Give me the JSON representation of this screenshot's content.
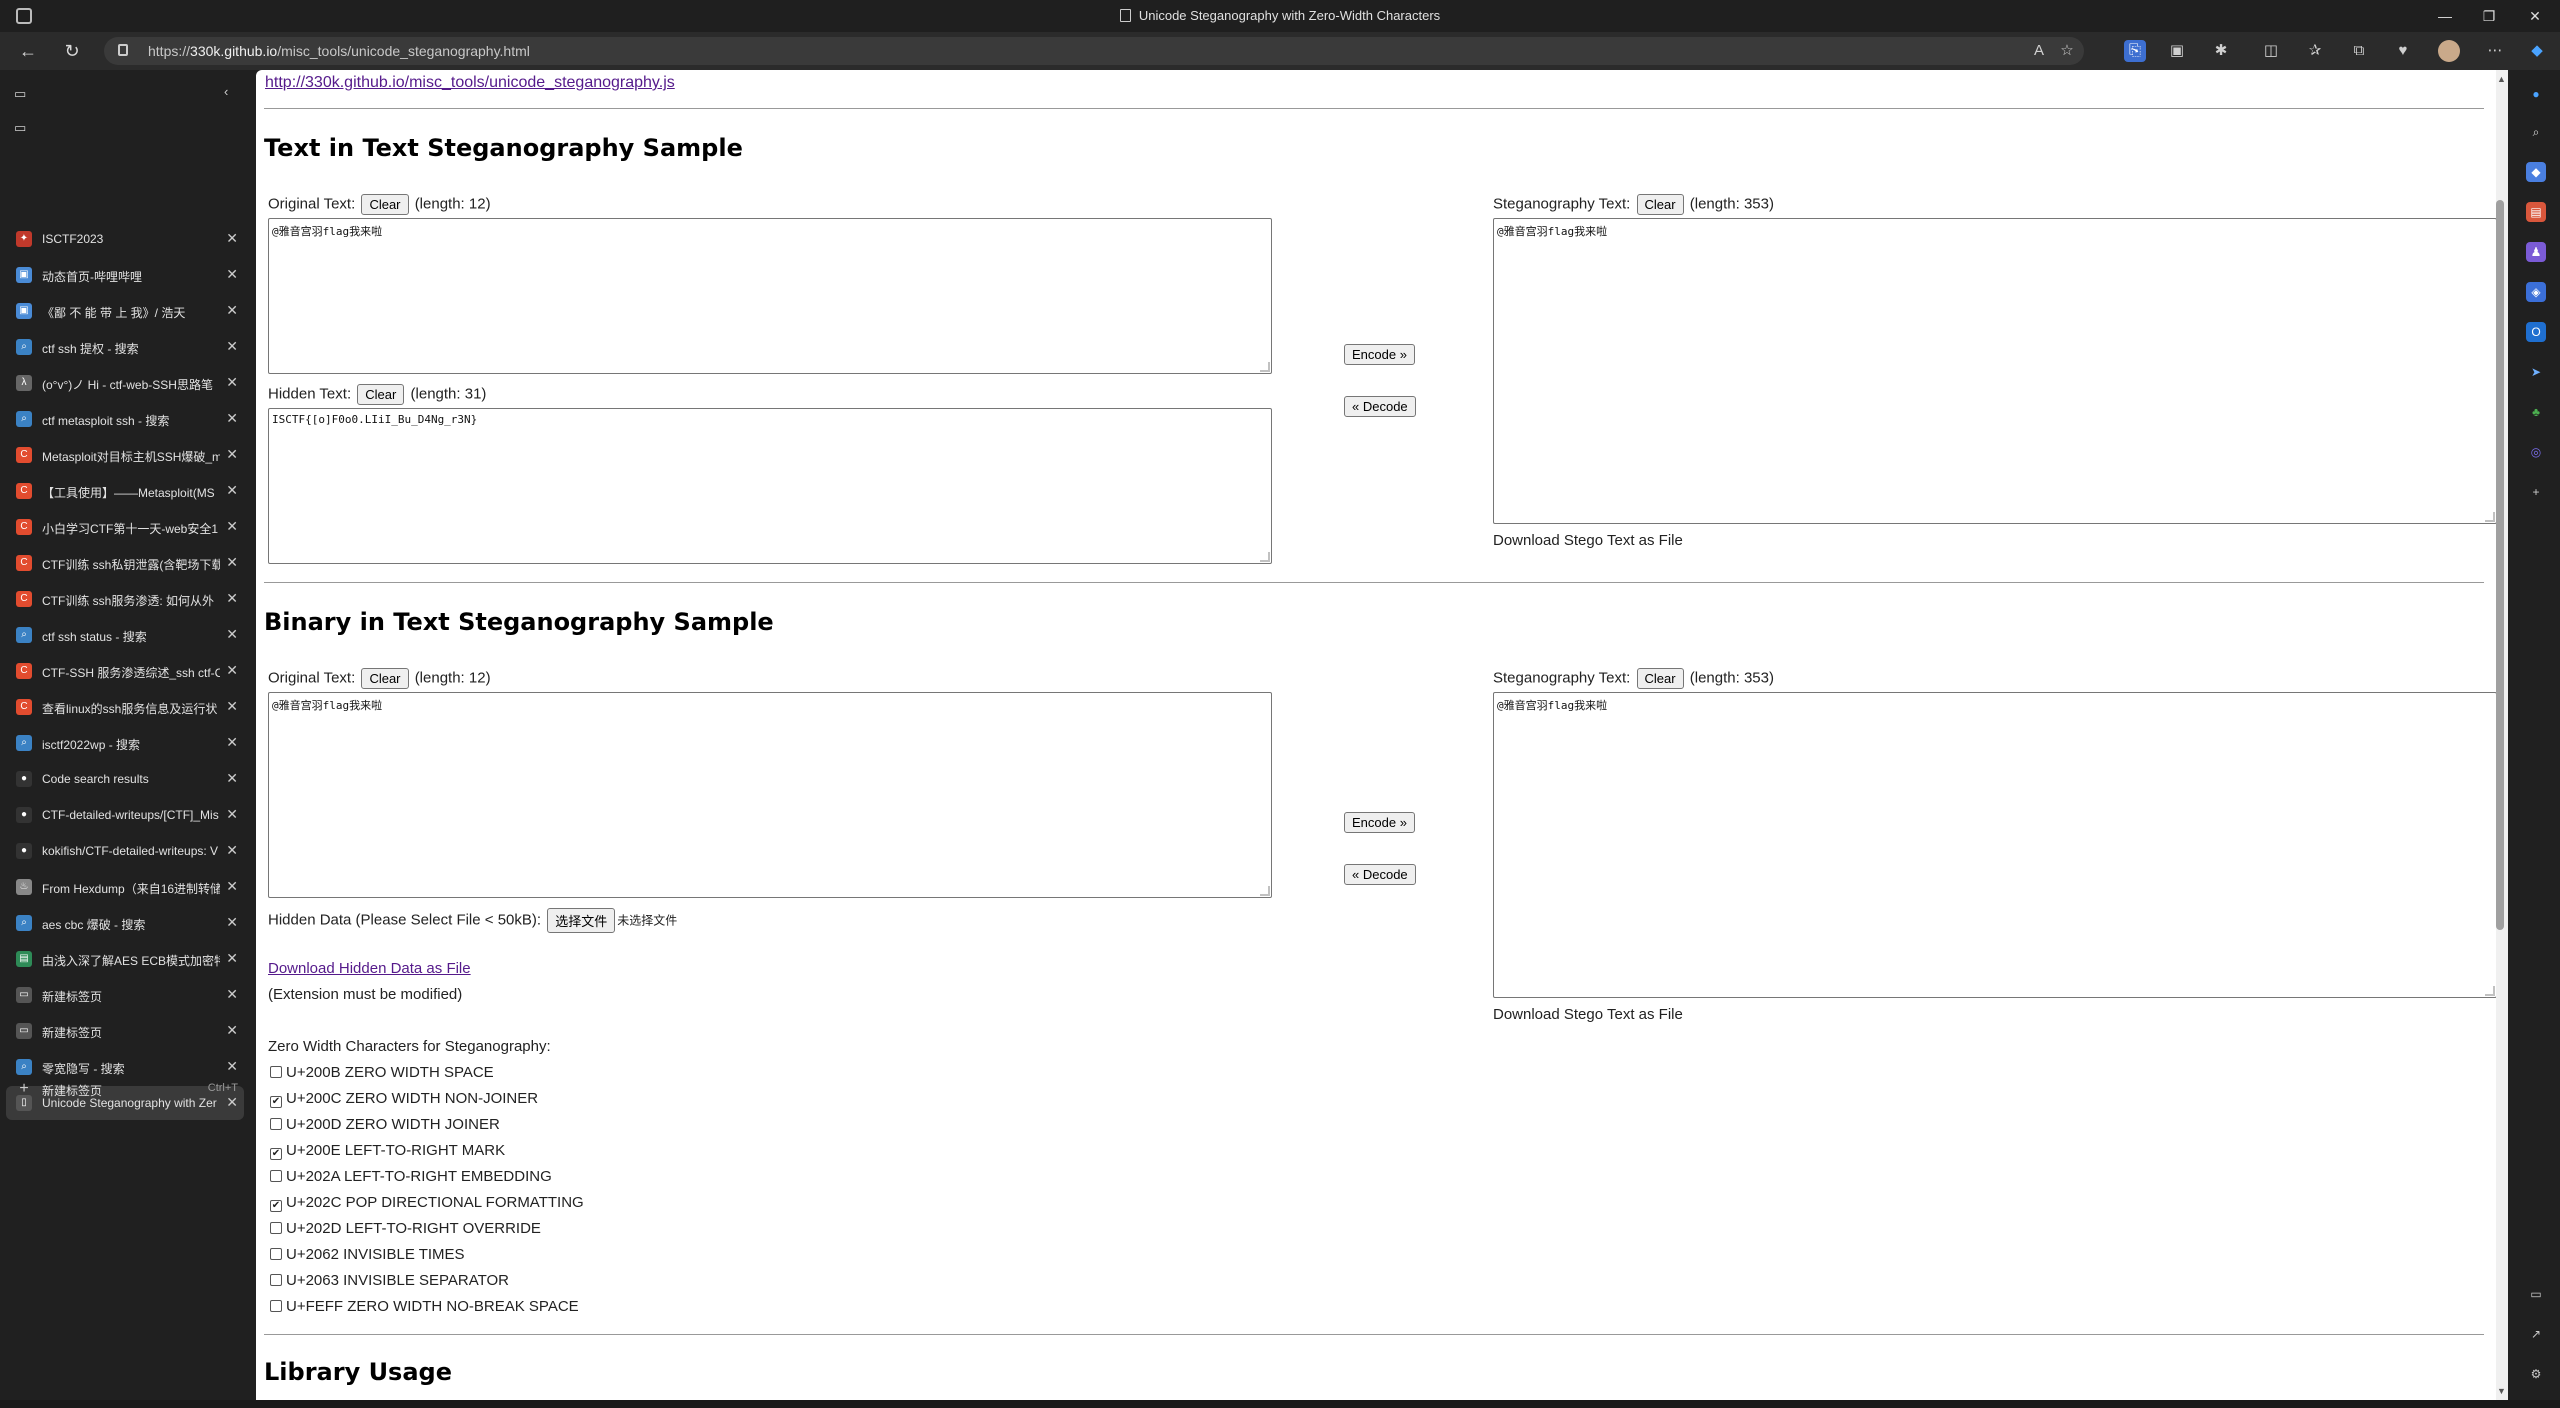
{
  "window": {
    "title": "Unicode Steganography with Zero-Width Characters"
  },
  "addressbar": {
    "url_prefix": "https://",
    "url_host": "330k.github.io",
    "url_path": "/misc_tools/unicode_steganography.html"
  },
  "sidebar": {
    "new_tab_label": "新建标签页",
    "new_tab_shortcut": "Ctrl+T",
    "tabs": [
      {
        "label": "ISCTF2023",
        "icon": "isctf-icon",
        "color": "#c0392b"
      },
      {
        "label": "动态首页-哔哩哔哩",
        "icon": "bilibili-icon",
        "color": "#4a8bd6"
      },
      {
        "label": "《鄙 不 能 带 上 我》/ 浩天",
        "icon": "bilibili-icon",
        "color": "#4a8bd6"
      },
      {
        "label": "ctf ssh 提权 - 搜索",
        "icon": "bing-search-icon",
        "color": "#3b82c4"
      },
      {
        "label": "(o°v°)ノ Hi - ctf-web-SSH思路笔",
        "icon": "lambda-icon",
        "color": "#666666"
      },
      {
        "label": "ctf metasploit ssh - 搜索",
        "icon": "bing-search-icon",
        "color": "#3b82c4"
      },
      {
        "label": "Metasploit对目标主机SSH爆破_m",
        "icon": "csdn-icon",
        "color": "#e24c2f"
      },
      {
        "label": "【工具使用】——Metasploit(MS",
        "icon": "csdn-icon",
        "color": "#e24c2f"
      },
      {
        "label": "小白学习CTF第十一天-web安全1",
        "icon": "csdn-icon",
        "color": "#e24c2f"
      },
      {
        "label": "CTF训练 ssh私钥泄露(含靶场下载",
        "icon": "csdn-icon",
        "color": "#e24c2f"
      },
      {
        "label": "CTF训练 ssh服务渗透: 如何从外",
        "icon": "csdn-icon",
        "color": "#e24c2f"
      },
      {
        "label": "ctf ssh status - 搜索",
        "icon": "bing-search-icon",
        "color": "#3b82c4"
      },
      {
        "label": "CTF-SSH 服务渗透综述_ssh ctf-C",
        "icon": "csdn-icon",
        "color": "#e24c2f"
      },
      {
        "label": "查看linux的ssh服务信息及运行状",
        "icon": "csdn-icon",
        "color": "#e24c2f"
      },
      {
        "label": "isctf2022wp - 搜索",
        "icon": "bing-search-icon",
        "color": "#3b82c4"
      },
      {
        "label": "Code search results",
        "icon": "github-icon",
        "color": "#333333"
      },
      {
        "label": "CTF-detailed-writeups/[CTF]_Mis",
        "icon": "github-icon",
        "color": "#333333"
      },
      {
        "label": "kokifish/CTF-detailed-writeups: V",
        "icon": "github-icon",
        "color": "#333333"
      },
      {
        "label": "From Hexdump（来自16进制转储",
        "icon": "cyberchef-icon",
        "color": "#888888"
      },
      {
        "label": "aes cbc 爆破 - 搜索",
        "icon": "bing-search-icon",
        "color": "#3b82c4"
      },
      {
        "label": "由浅入深了解AES ECB模式加密特",
        "icon": "green-doc-icon",
        "color": "#2e8b57"
      },
      {
        "label": "新建标签页",
        "icon": "newtab-icon",
        "color": "#555555"
      },
      {
        "label": "新建标签页",
        "icon": "newtab-icon",
        "color": "#555555"
      },
      {
        "label": "零宽隐写 - 搜索",
        "icon": "bing-search-icon",
        "color": "#3b82c4"
      },
      {
        "label": "Unicode Steganography with Zer",
        "icon": "document-icon",
        "color": "#555555"
      }
    ]
  },
  "page": {
    "lib_link": "http://330k.github.io/misc_tools/unicode_steganography.js",
    "section1": {
      "heading": "Text in Text Steganography Sample",
      "original_label": "Original Text:",
      "original_length": "(length: 12)",
      "original_value": "@雅音宫羽flag我来啦",
      "hidden_label": "Hidden Text:",
      "hidden_length": "(length: 31)",
      "hidden_value": "ISCTF{[o]F0o0.LIiI_Bu_D4Ng_r3N}",
      "stego_label": "Steganography Text:",
      "stego_length": "(length: 353)",
      "stego_value": "@雅音宫羽flag我来啦",
      "encode_btn": "Encode »",
      "decode_btn": "« Decode",
      "download_stego": "Download Stego Text as File"
    },
    "section2": {
      "heading": "Binary in Text Steganography Sample",
      "original_label": "Original Text:",
      "original_length": "(length: 12)",
      "original_value": "@雅音宫羽flag我来啦",
      "stego_label": "Steganography Text:",
      "stego_length": "(length: 353)",
      "stego_value": "@雅音宫羽flag我来啦",
      "encode_btn": "Encode »",
      "decode_btn": "« Decode",
      "hidden_data_label": "Hidden Data (Please Select File < 50kB):",
      "choose_file_btn": "选择文件",
      "no_file": "未选择文件",
      "download_hidden": "Download Hidden Data as File",
      "extension_note": "(Extension must be modified)",
      "download_stego": "Download Stego Text as File",
      "zw_heading": "Zero Width Characters for Steganography:",
      "zw_chars": [
        {
          "label": "U+200B ZERO WIDTH SPACE",
          "checked": false
        },
        {
          "label": "U+200C ZERO WIDTH NON-JOINER",
          "checked": true
        },
        {
          "label": "U+200D ZERO WIDTH JOINER",
          "checked": false
        },
        {
          "label": "U+200E LEFT-TO-RIGHT MARK",
          "checked": true
        },
        {
          "label": "U+202A LEFT-TO-RIGHT EMBEDDING",
          "checked": false
        },
        {
          "label": "U+202C POP DIRECTIONAL FORMATTING",
          "checked": true
        },
        {
          "label": "U+202D LEFT-TO-RIGHT OVERRIDE",
          "checked": false
        },
        {
          "label": "U+2062 INVISIBLE TIMES",
          "checked": false
        },
        {
          "label": "U+2063 INVISIBLE SEPARATOR",
          "checked": false
        },
        {
          "label": "U+FEFF ZERO WIDTH NO-BREAK SPACE",
          "checked": false
        }
      ]
    },
    "section3": {
      "heading": "Library Usage"
    },
    "clear_btn": "Clear"
  }
}
